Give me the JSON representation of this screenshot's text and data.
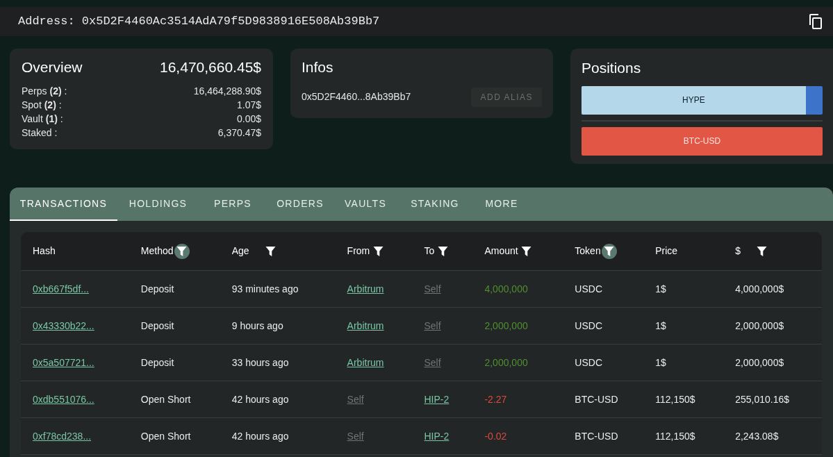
{
  "address_bar": {
    "label": "Address:",
    "address": "0x5D2F4460Ac3514AdA79f5D9838916E508Ab39Bb7"
  },
  "overview": {
    "title": "Overview",
    "total": "16,470,660.45$",
    "rows": [
      {
        "label": "Perps **(2)** :",
        "value": "16,464,288.90$"
      },
      {
        "label": "Spot **(2)** :",
        "value": "1.07$"
      },
      {
        "label": "Vault **(1)** :",
        "value": "0.00$"
      },
      {
        "label": "Staked :",
        "value": "6,370.47$"
      }
    ]
  },
  "infos": {
    "title": "Infos",
    "address": "0x5D2F4460...8Ab39Bb7",
    "button": "ADD ALIAS"
  },
  "positions": {
    "title": "Positions",
    "items": [
      {
        "label": "HYPE",
        "color": "#b4d8ea",
        "level": 0.93
      },
      {
        "label": "BTC-USD",
        "color": "#e25646",
        "level": 1
      }
    ]
  },
  "tabs": [
    {
      "label": "TRANSACTIONS",
      "selected": true
    },
    {
      "label": "HOLDINGS",
      "selected": false
    },
    {
      "label": "PERPS",
      "selected": false
    },
    {
      "label": "ORDERS",
      "selected": false
    },
    {
      "label": "VAULTS",
      "selected": false
    },
    {
      "label": "STAKING",
      "selected": false
    },
    {
      "label": "MORE",
      "selected": false
    }
  ],
  "table": {
    "columns": [
      {
        "label": "Hash",
        "filter": false,
        "filter_active": false
      },
      {
        "label": "Method",
        "filter": true,
        "filter_active": true
      },
      {
        "label": "Age",
        "filter": true,
        "filter_active": false
      },
      {
        "label": "From",
        "filter": true,
        "filter_active": false
      },
      {
        "label": "To",
        "filter": true,
        "filter_active": false
      },
      {
        "label": "Amount",
        "filter": true,
        "filter_active": false
      },
      {
        "label": "Token",
        "filter": true,
        "filter_active": true
      },
      {
        "label": "Price",
        "filter": false,
        "filter_active": false
      },
      {
        "label": "$",
        "filter": true,
        "filter_active": false
      }
    ],
    "rows": [
      {
        "hash": "0xb667f5df...",
        "method": "Deposit",
        "age": "93 minutes ago",
        "from": {
          "text": "Arbitrum",
          "dimmed": false
        },
        "to": {
          "text": "Self",
          "dimmed": true
        },
        "amount": {
          "text": "4,000,000",
          "color": "#4f8f2e"
        },
        "token": "USDC",
        "price": "1$",
        "usd": "4,000,000$"
      },
      {
        "hash": "0x43330b22...",
        "method": "Deposit",
        "age": "9 hours ago",
        "from": {
          "text": "Arbitrum",
          "dimmed": false
        },
        "to": {
          "text": "Self",
          "dimmed": true
        },
        "amount": {
          "text": "2,000,000",
          "color": "#4f8f2e"
        },
        "token": "USDC",
        "price": "1$",
        "usd": "2,000,000$"
      },
      {
        "hash": "0x5a507721...",
        "method": "Deposit",
        "age": "33 hours ago",
        "from": {
          "text": "Arbitrum",
          "dimmed": false
        },
        "to": {
          "text": "Self",
          "dimmed": true
        },
        "amount": {
          "text": "2,000,000",
          "color": "#4f8f2e"
        },
        "token": "USDC",
        "price": "1$",
        "usd": "2,000,000$"
      },
      {
        "hash": "0xdb551076...",
        "method": "Open Short",
        "age": "42 hours ago",
        "from": {
          "text": "Self",
          "dimmed": true
        },
        "to": {
          "text": "HIP-2",
          "dimmed": false
        },
        "amount": {
          "text": "-2.27",
          "color": "#e0493b"
        },
        "token": "BTC-USD",
        "price": "112,150$",
        "usd": "255,010.16$"
      },
      {
        "hash": "0xf78cd238...",
        "method": "Open Short",
        "age": "42 hours ago",
        "from": {
          "text": "Self",
          "dimmed": true
        },
        "to": {
          "text": "HIP-2",
          "dimmed": false
        },
        "amount": {
          "text": "-0.02",
          "color": "#e0493b"
        },
        "token": "BTC-USD",
        "price": "112,150$",
        "usd": "2,243.08$"
      }
    ]
  }
}
